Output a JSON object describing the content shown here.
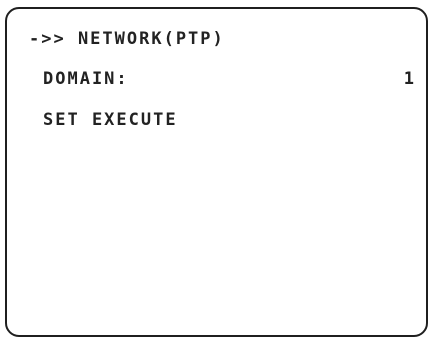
{
  "menu": {
    "title": "->> NETWORK(PTP)",
    "items": [
      {
        "label": "DOMAIN:",
        "value": "1"
      },
      {
        "label": "SET EXECUTE"
      }
    ]
  }
}
